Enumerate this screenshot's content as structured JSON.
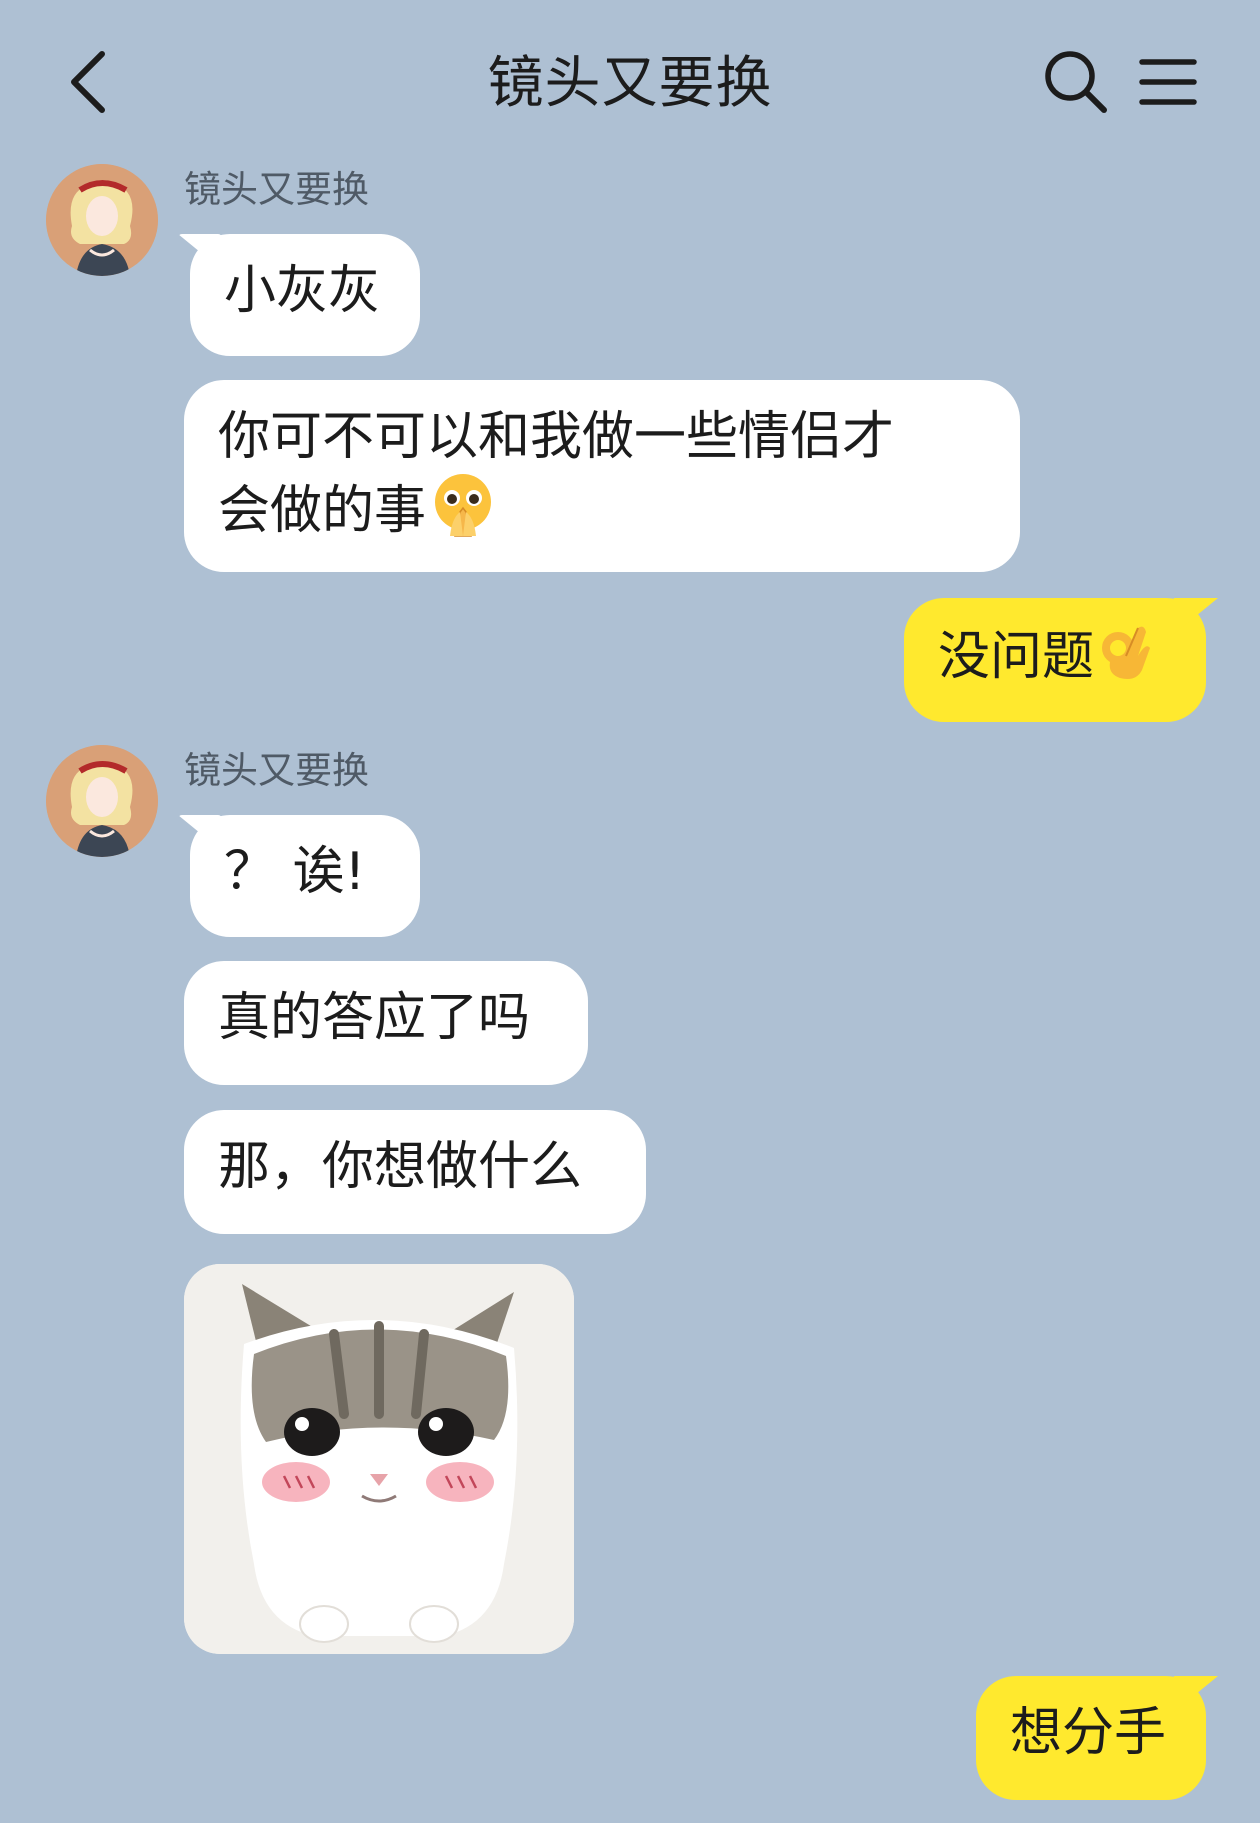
{
  "header": {
    "title": "镜头又要换",
    "back_icon": "chevron-left-icon",
    "search_icon": "search-icon",
    "menu_icon": "menu-icon"
  },
  "messages": [
    {
      "sender": "镜头又要换",
      "text": "小灰灰"
    },
    {
      "text": "你可不可以和我做一些情侣才",
      "text2": "会做的事",
      "emoji": "pleading-hands-emoji"
    },
    {
      "mine": true,
      "text": "没问题",
      "emoji": "ok-hand-emoji"
    },
    {
      "sender": "镜头又要换",
      "text": "？ 诶!"
    },
    {
      "text": "真的答应了吗"
    },
    {
      "text": "那，你想做什么"
    },
    {
      "sticker": "crying-cat-sticker"
    },
    {
      "mine": true,
      "text": "想分手"
    }
  ],
  "colors": {
    "background": "#aec0d3",
    "incoming_bubble": "#ffffff",
    "outgoing_bubble": "#ffe92e"
  }
}
